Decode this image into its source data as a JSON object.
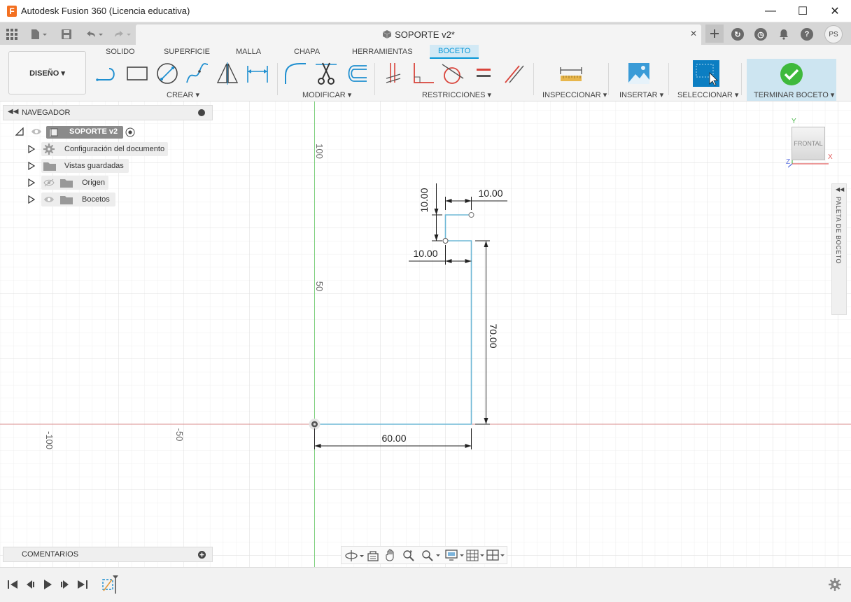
{
  "window": {
    "title": "Autodesk Fusion 360 (Licencia educativa)",
    "app_icon_letter": "F",
    "controls": {
      "minimize": "—",
      "maximize": "☐",
      "close": "✕"
    }
  },
  "appbar": {
    "document_title": "SOPORTE v2*",
    "close_glyph": "✕",
    "user_initials": "PS"
  },
  "ribbon": {
    "workspace": "DISEÑO ▾",
    "tabs": [
      "SOLIDO",
      "SUPERFICIE",
      "MALLA",
      "CHAPA",
      "HERRAMIENTAS",
      "BOCETO"
    ],
    "active_tab": "BOCETO",
    "groups": {
      "crear": "CREAR ▾",
      "modificar": "MODIFICAR ▾",
      "restricciones": "RESTRICCIONES ▾",
      "inspeccionar": "INSPECCIONAR ▾",
      "insertar": "INSERTAR ▾",
      "seleccionar": "SELECCIONAR ▾",
      "terminar": "TERMINAR BOCETO ▾"
    }
  },
  "browser": {
    "title": "NAVEGADOR",
    "root": "SOPORTE v2",
    "items": [
      "Configuración del documento",
      "Vistas guardadas",
      "Origen",
      "Bocetos"
    ]
  },
  "comments": {
    "title": "COMENTARIOS"
  },
  "canvas": {
    "axis_labels": {
      "y100": "100",
      "y50": "50",
      "xneg100": "-100",
      "xneg50": "-50"
    },
    "dimensions": {
      "bottom": "60.00",
      "right": "70.00",
      "top_vertical": "10.00",
      "top_horizontal": "10.00",
      "middle_horizontal": "10.00"
    },
    "viewcube": {
      "face": "FRONTAL",
      "x": "X",
      "y": "Y",
      "z": "Z"
    },
    "palette": "PALETA DE BOCETO"
  },
  "colors": {
    "accent": "#0696d7",
    "sketch_line": "#6fb8d6",
    "x_axis": "#d98c8c",
    "y_axis": "#7ccf7c",
    "constraint_red": "#d9443b",
    "finish_green": "#3fb93c"
  }
}
